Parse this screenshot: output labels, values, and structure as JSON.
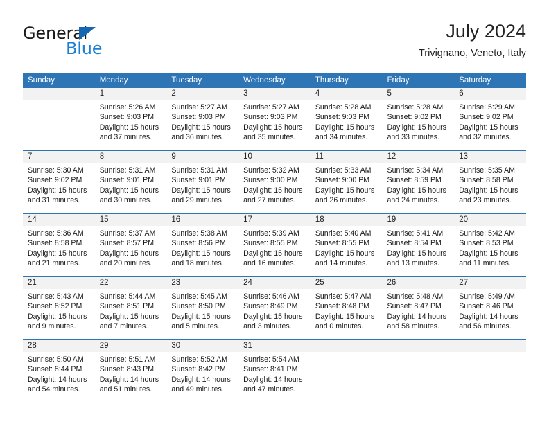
{
  "brand": {
    "word1": "General",
    "word2": "Blue",
    "triangle_color": "#1667b2",
    "blue_color": "#1b7fd4"
  },
  "header": {
    "title": "July 2024",
    "subtitle": "Trivignano, Veneto, Italy"
  },
  "theme": {
    "header_bar": "#2e75b6",
    "daynum_bar": "#f2f2f2",
    "text": "#1a1a1a"
  },
  "weekday_headers": [
    "Sunday",
    "Monday",
    "Tuesday",
    "Wednesday",
    "Thursday",
    "Friday",
    "Saturday"
  ],
  "weeks": [
    [
      {
        "day": "",
        "sunrise": "",
        "sunset": "",
        "daylight1": "",
        "daylight2": ""
      },
      {
        "day": "1",
        "sunrise": "Sunrise: 5:26 AM",
        "sunset": "Sunset: 9:03 PM",
        "daylight1": "Daylight: 15 hours",
        "daylight2": "and 37 minutes."
      },
      {
        "day": "2",
        "sunrise": "Sunrise: 5:27 AM",
        "sunset": "Sunset: 9:03 PM",
        "daylight1": "Daylight: 15 hours",
        "daylight2": "and 36 minutes."
      },
      {
        "day": "3",
        "sunrise": "Sunrise: 5:27 AM",
        "sunset": "Sunset: 9:03 PM",
        "daylight1": "Daylight: 15 hours",
        "daylight2": "and 35 minutes."
      },
      {
        "day": "4",
        "sunrise": "Sunrise: 5:28 AM",
        "sunset": "Sunset: 9:03 PM",
        "daylight1": "Daylight: 15 hours",
        "daylight2": "and 34 minutes."
      },
      {
        "day": "5",
        "sunrise": "Sunrise: 5:28 AM",
        "sunset": "Sunset: 9:02 PM",
        "daylight1": "Daylight: 15 hours",
        "daylight2": "and 33 minutes."
      },
      {
        "day": "6",
        "sunrise": "Sunrise: 5:29 AM",
        "sunset": "Sunset: 9:02 PM",
        "daylight1": "Daylight: 15 hours",
        "daylight2": "and 32 minutes."
      }
    ],
    [
      {
        "day": "7",
        "sunrise": "Sunrise: 5:30 AM",
        "sunset": "Sunset: 9:02 PM",
        "daylight1": "Daylight: 15 hours",
        "daylight2": "and 31 minutes."
      },
      {
        "day": "8",
        "sunrise": "Sunrise: 5:31 AM",
        "sunset": "Sunset: 9:01 PM",
        "daylight1": "Daylight: 15 hours",
        "daylight2": "and 30 minutes."
      },
      {
        "day": "9",
        "sunrise": "Sunrise: 5:31 AM",
        "sunset": "Sunset: 9:01 PM",
        "daylight1": "Daylight: 15 hours",
        "daylight2": "and 29 minutes."
      },
      {
        "day": "10",
        "sunrise": "Sunrise: 5:32 AM",
        "sunset": "Sunset: 9:00 PM",
        "daylight1": "Daylight: 15 hours",
        "daylight2": "and 27 minutes."
      },
      {
        "day": "11",
        "sunrise": "Sunrise: 5:33 AM",
        "sunset": "Sunset: 9:00 PM",
        "daylight1": "Daylight: 15 hours",
        "daylight2": "and 26 minutes."
      },
      {
        "day": "12",
        "sunrise": "Sunrise: 5:34 AM",
        "sunset": "Sunset: 8:59 PM",
        "daylight1": "Daylight: 15 hours",
        "daylight2": "and 24 minutes."
      },
      {
        "day": "13",
        "sunrise": "Sunrise: 5:35 AM",
        "sunset": "Sunset: 8:58 PM",
        "daylight1": "Daylight: 15 hours",
        "daylight2": "and 23 minutes."
      }
    ],
    [
      {
        "day": "14",
        "sunrise": "Sunrise: 5:36 AM",
        "sunset": "Sunset: 8:58 PM",
        "daylight1": "Daylight: 15 hours",
        "daylight2": "and 21 minutes."
      },
      {
        "day": "15",
        "sunrise": "Sunrise: 5:37 AM",
        "sunset": "Sunset: 8:57 PM",
        "daylight1": "Daylight: 15 hours",
        "daylight2": "and 20 minutes."
      },
      {
        "day": "16",
        "sunrise": "Sunrise: 5:38 AM",
        "sunset": "Sunset: 8:56 PM",
        "daylight1": "Daylight: 15 hours",
        "daylight2": "and 18 minutes."
      },
      {
        "day": "17",
        "sunrise": "Sunrise: 5:39 AM",
        "sunset": "Sunset: 8:55 PM",
        "daylight1": "Daylight: 15 hours",
        "daylight2": "and 16 minutes."
      },
      {
        "day": "18",
        "sunrise": "Sunrise: 5:40 AM",
        "sunset": "Sunset: 8:55 PM",
        "daylight1": "Daylight: 15 hours",
        "daylight2": "and 14 minutes."
      },
      {
        "day": "19",
        "sunrise": "Sunrise: 5:41 AM",
        "sunset": "Sunset: 8:54 PM",
        "daylight1": "Daylight: 15 hours",
        "daylight2": "and 13 minutes."
      },
      {
        "day": "20",
        "sunrise": "Sunrise: 5:42 AM",
        "sunset": "Sunset: 8:53 PM",
        "daylight1": "Daylight: 15 hours",
        "daylight2": "and 11 minutes."
      }
    ],
    [
      {
        "day": "21",
        "sunrise": "Sunrise: 5:43 AM",
        "sunset": "Sunset: 8:52 PM",
        "daylight1": "Daylight: 15 hours",
        "daylight2": "and 9 minutes."
      },
      {
        "day": "22",
        "sunrise": "Sunrise: 5:44 AM",
        "sunset": "Sunset: 8:51 PM",
        "daylight1": "Daylight: 15 hours",
        "daylight2": "and 7 minutes."
      },
      {
        "day": "23",
        "sunrise": "Sunrise: 5:45 AM",
        "sunset": "Sunset: 8:50 PM",
        "daylight1": "Daylight: 15 hours",
        "daylight2": "and 5 minutes."
      },
      {
        "day": "24",
        "sunrise": "Sunrise: 5:46 AM",
        "sunset": "Sunset: 8:49 PM",
        "daylight1": "Daylight: 15 hours",
        "daylight2": "and 3 minutes."
      },
      {
        "day": "25",
        "sunrise": "Sunrise: 5:47 AM",
        "sunset": "Sunset: 8:48 PM",
        "daylight1": "Daylight: 15 hours",
        "daylight2": "and 0 minutes."
      },
      {
        "day": "26",
        "sunrise": "Sunrise: 5:48 AM",
        "sunset": "Sunset: 8:47 PM",
        "daylight1": "Daylight: 14 hours",
        "daylight2": "and 58 minutes."
      },
      {
        "day": "27",
        "sunrise": "Sunrise: 5:49 AM",
        "sunset": "Sunset: 8:46 PM",
        "daylight1": "Daylight: 14 hours",
        "daylight2": "and 56 minutes."
      }
    ],
    [
      {
        "day": "28",
        "sunrise": "Sunrise: 5:50 AM",
        "sunset": "Sunset: 8:44 PM",
        "daylight1": "Daylight: 14 hours",
        "daylight2": "and 54 minutes."
      },
      {
        "day": "29",
        "sunrise": "Sunrise: 5:51 AM",
        "sunset": "Sunset: 8:43 PM",
        "daylight1": "Daylight: 14 hours",
        "daylight2": "and 51 minutes."
      },
      {
        "day": "30",
        "sunrise": "Sunrise: 5:52 AM",
        "sunset": "Sunset: 8:42 PM",
        "daylight1": "Daylight: 14 hours",
        "daylight2": "and 49 minutes."
      },
      {
        "day": "31",
        "sunrise": "Sunrise: 5:54 AM",
        "sunset": "Sunset: 8:41 PM",
        "daylight1": "Daylight: 14 hours",
        "daylight2": "and 47 minutes."
      },
      {
        "day": "",
        "sunrise": "",
        "sunset": "",
        "daylight1": "",
        "daylight2": ""
      },
      {
        "day": "",
        "sunrise": "",
        "sunset": "",
        "daylight1": "",
        "daylight2": ""
      },
      {
        "day": "",
        "sunrise": "",
        "sunset": "",
        "daylight1": "",
        "daylight2": ""
      }
    ]
  ]
}
